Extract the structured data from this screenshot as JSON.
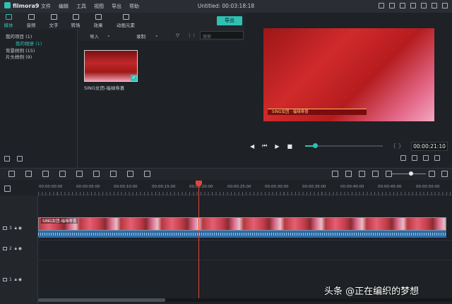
{
  "app": {
    "name": "filmora9",
    "window_title": "Untitled: 00:03:18:18"
  },
  "menu": [
    "文件",
    "编辑",
    "工具",
    "视图",
    "导出",
    "帮助"
  ],
  "tabs": [
    {
      "label": "媒体",
      "icon": "folder-icon",
      "active": true
    },
    {
      "label": "音频",
      "icon": "music-icon"
    },
    {
      "label": "文字",
      "icon": "text-icon"
    },
    {
      "label": "转场",
      "icon": "transition-icon"
    },
    {
      "label": "效果",
      "icon": "effects-icon"
    },
    {
      "label": "动画元素",
      "icon": "elements-icon"
    }
  ],
  "export_label": "导出",
  "library": {
    "items": [
      {
        "label": "我的项目 (1)"
      },
      {
        "label": "我的相册 (1)",
        "sub": true
      },
      {
        "label": "背景样例 (15)"
      },
      {
        "label": "片头样例 (9)"
      }
    ]
  },
  "mediabar": {
    "import_label": "导入",
    "record_label": "录制",
    "search_placeholder": "搜索"
  },
  "media_item": {
    "label": "SING女团-福禄寿喜"
  },
  "video": {
    "banner_text": "SING女团 · 福禄寿喜"
  },
  "preview": {
    "timecode": "00:00:21:10",
    "bracket_label": "{ }"
  },
  "ruler": {
    "labels": [
      "00:00:00:00",
      "00:00:05:00",
      "00:00:10:00",
      "00:00:15:00",
      "00:00:20:00",
      "00:00:25:00",
      "00:00:30:00",
      "00:00:35:00",
      "00:00:40:00",
      "00:00:45:00",
      "00:00:50:00"
    ]
  },
  "tracks": [
    {
      "label": "3"
    },
    {
      "label": "2"
    },
    {
      "label": "1"
    }
  ],
  "clip": {
    "label": "SING女团-福禄寿喜"
  },
  "watermark": "头条 @正在编织的梦想",
  "colors": {
    "accent": "#2fc1b4",
    "playhead": "#e0473c",
    "audio": "#2b6ca8"
  }
}
